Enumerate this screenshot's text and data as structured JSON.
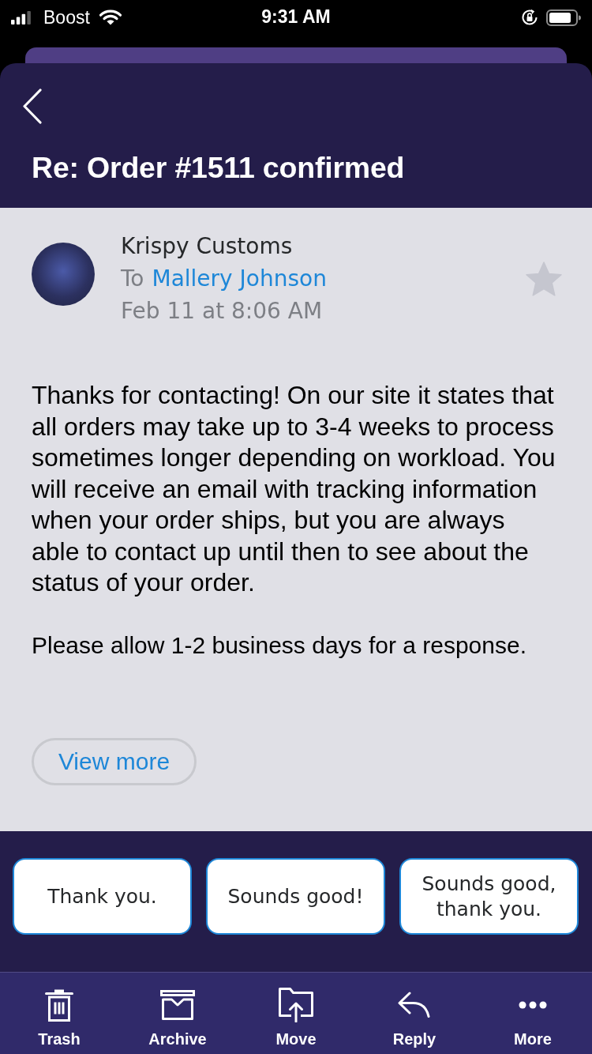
{
  "status_bar": {
    "carrier": "Boost",
    "time": "9:31 AM"
  },
  "header": {
    "title": "Re: Order #1511 confirmed"
  },
  "message": {
    "sender": "Krispy Customs",
    "to_label": "To",
    "recipient": "Mallery Johnson",
    "date": "Feb 11 at 8:06 AM",
    "starred": false,
    "paragraphs": [
      "Thanks for contacting! On our site it states that all orders may take up to 3-4 weeks to process sometimes longer depending on workload. You will receive an email with tracking information when your order ships, but you are always able to contact up until then to see about the status of your order.",
      "Please allow 1-2 business days for a response."
    ],
    "view_more": "View more"
  },
  "quick_replies": [
    "Thank you.",
    "Sounds good!",
    "Sounds good, thank you."
  ],
  "toolbar": [
    {
      "kind": "trash",
      "label": "Trash"
    },
    {
      "kind": "archive",
      "label": "Archive"
    },
    {
      "kind": "move",
      "label": "Move"
    },
    {
      "kind": "reply",
      "label": "Reply"
    },
    {
      "kind": "more",
      "label": "More"
    }
  ]
}
